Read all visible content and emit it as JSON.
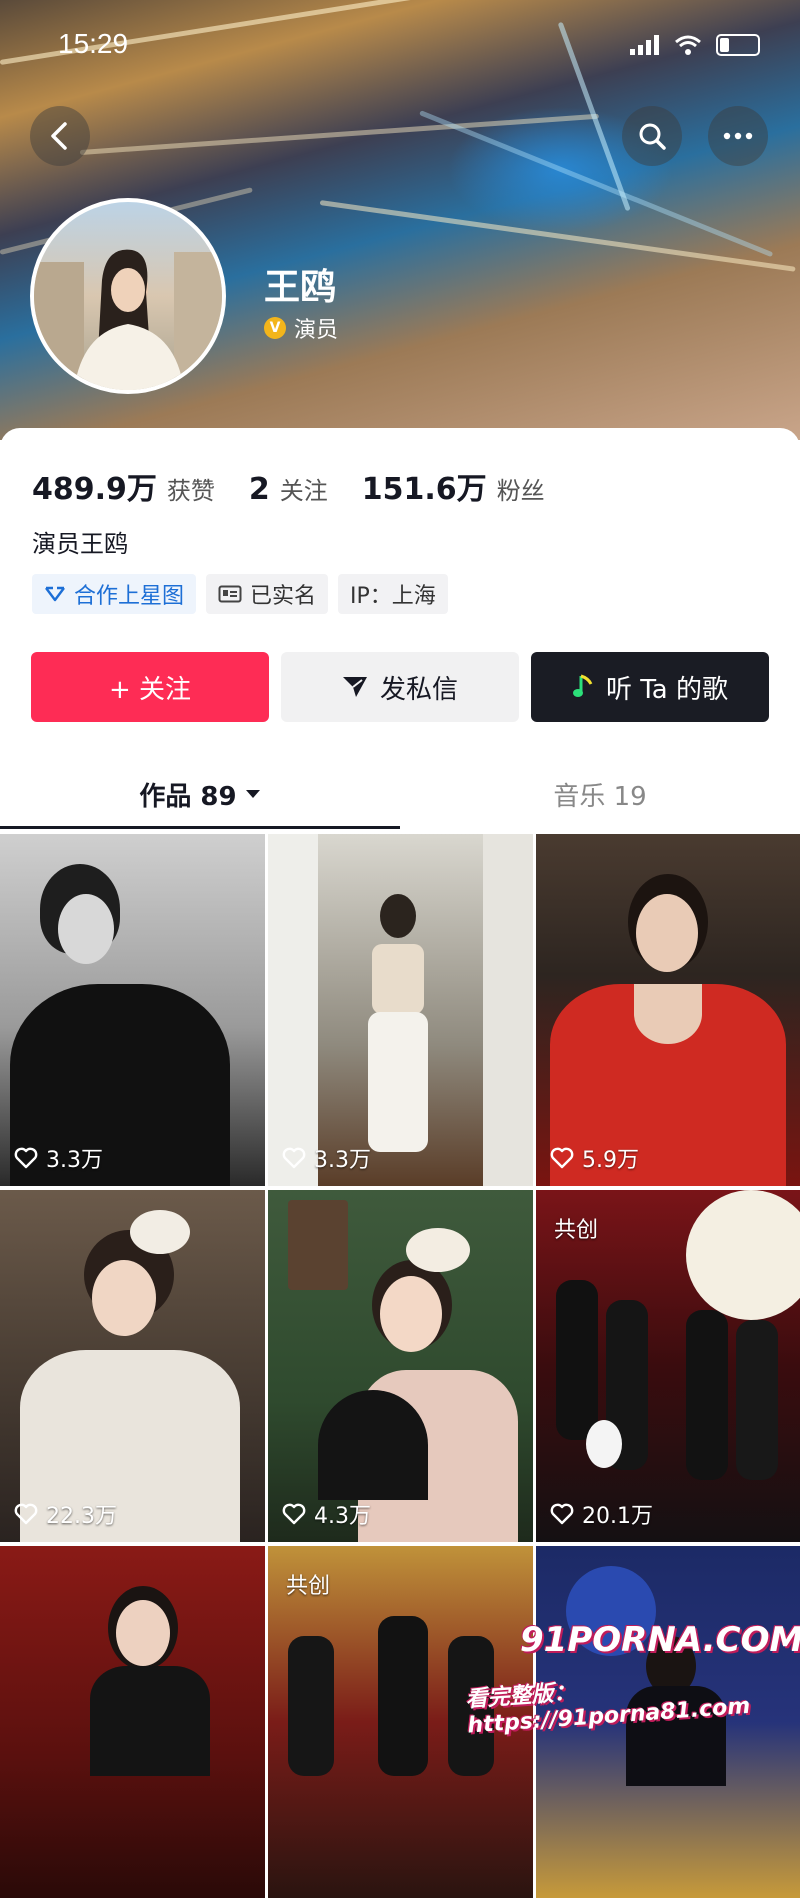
{
  "status_bar": {
    "time": "15:29"
  },
  "header": {
    "back_icon": "chevron-left-icon",
    "search_icon": "search-icon",
    "more_icon": "more-dots-icon"
  },
  "profile": {
    "name": "王鸥",
    "verified_label": "演员",
    "stats": [
      {
        "value": "489.9万",
        "label": "获赞"
      },
      {
        "value": "2",
        "label": "关注"
      },
      {
        "value": "151.6万",
        "label": "粉丝"
      }
    ],
    "bio": "演员王鸥",
    "tags": [
      {
        "label": "合作上星图",
        "icon": "star-map-icon"
      },
      {
        "label": "已实名",
        "icon": "id-card-icon"
      },
      {
        "label": "IP：上海",
        "icon": ""
      }
    ]
  },
  "actions": {
    "follow": "+ 关注",
    "message": "发私信",
    "songs": "听 Ta 的歌"
  },
  "tabs": [
    {
      "label": "作品 89"
    },
    {
      "label": "音乐 19"
    }
  ],
  "videos": [
    {
      "likes": "3.3万",
      "co_created": ""
    },
    {
      "likes": "3.3万",
      "co_created": ""
    },
    {
      "likes": "5.9万",
      "co_created": ""
    },
    {
      "likes": "22.3万",
      "co_created": ""
    },
    {
      "likes": "4.3万",
      "co_created": ""
    },
    {
      "likes": "20.1万",
      "co_created": "共创"
    },
    {
      "likes": "",
      "co_created": ""
    },
    {
      "likes": "",
      "co_created": "共创"
    },
    {
      "likes": "",
      "co_created": ""
    }
  ],
  "watermark": {
    "brand": "91PORNA.COM",
    "url": "看完整版：https://91porna81.com"
  },
  "colors": {
    "accent": "#fe2c55",
    "dark_button": "#1a1c24",
    "tag_blue": "#1d6fd6"
  }
}
